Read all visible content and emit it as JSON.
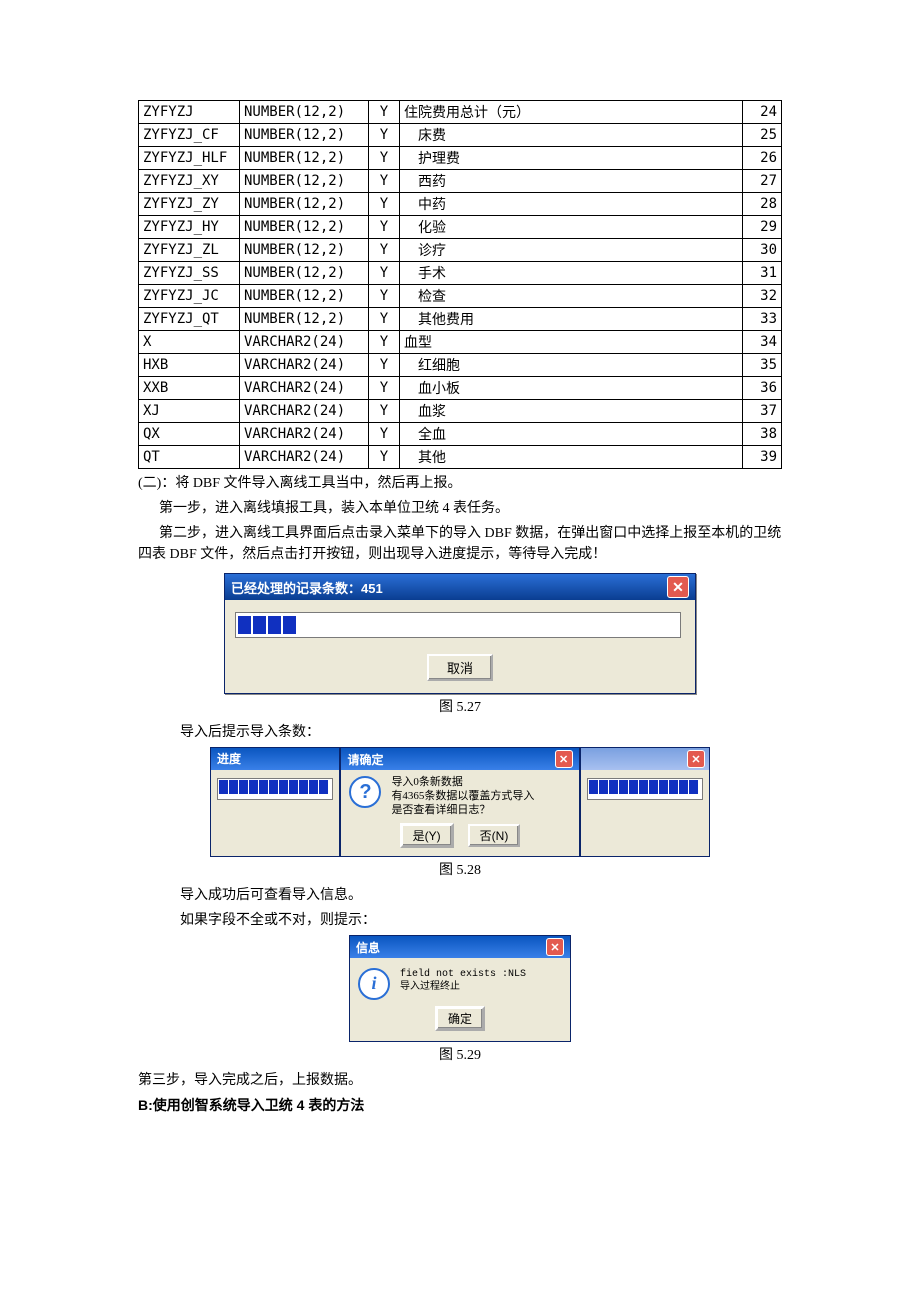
{
  "table_rows": [
    {
      "field": "ZYFYZJ",
      "type": "NUMBER(12,2)",
      "flag": "Y",
      "desc": "住院费用总计（元）",
      "indent": false,
      "num": "24"
    },
    {
      "field": "ZYFYZJ_CF",
      "type": "NUMBER(12,2)",
      "flag": "Y",
      "desc": "床费",
      "indent": true,
      "num": "25"
    },
    {
      "field": "ZYFYZJ_HLF",
      "type": "NUMBER(12,2)",
      "flag": "Y",
      "desc": "护理费",
      "indent": true,
      "num": "26"
    },
    {
      "field": "ZYFYZJ_XY",
      "type": "NUMBER(12,2)",
      "flag": "Y",
      "desc": "西药",
      "indent": true,
      "num": "27"
    },
    {
      "field": "ZYFYZJ_ZY",
      "type": "NUMBER(12,2)",
      "flag": "Y",
      "desc": "中药",
      "indent": true,
      "num": "28"
    },
    {
      "field": "ZYFYZJ_HY",
      "type": "NUMBER(12,2)",
      "flag": "Y",
      "desc": "化验",
      "indent": true,
      "num": "29"
    },
    {
      "field": "ZYFYZJ_ZL",
      "type": "NUMBER(12,2)",
      "flag": "Y",
      "desc": "诊疗",
      "indent": true,
      "num": "30"
    },
    {
      "field": "ZYFYZJ_SS",
      "type": "NUMBER(12,2)",
      "flag": "Y",
      "desc": "手术",
      "indent": true,
      "num": "31"
    },
    {
      "field": "ZYFYZJ_JC",
      "type": "NUMBER(12,2)",
      "flag": "Y",
      "desc": "检查",
      "indent": true,
      "num": "32"
    },
    {
      "field": "ZYFYZJ_QT",
      "type": "NUMBER(12,2)",
      "flag": "Y",
      "desc": "其他费用",
      "indent": true,
      "num": "33"
    },
    {
      "field": "X",
      "type": "VARCHAR2(24)",
      "flag": "Y",
      "desc": "血型",
      "indent": false,
      "num": "34"
    },
    {
      "field": "HXB",
      "type": "VARCHAR2(24)",
      "flag": "Y",
      "desc": "红细胞",
      "indent": true,
      "num": "35"
    },
    {
      "field": "XXB",
      "type": "VARCHAR2(24)",
      "flag": "Y",
      "desc": "血小板",
      "indent": true,
      "num": "36"
    },
    {
      "field": "XJ",
      "type": "VARCHAR2(24)",
      "flag": "Y",
      "desc": "血浆",
      "indent": true,
      "num": "37"
    },
    {
      "field": "QX",
      "type": "VARCHAR2(24)",
      "flag": "Y",
      "desc": "全血",
      "indent": true,
      "num": "38"
    },
    {
      "field": "QT",
      "type": "VARCHAR2(24)",
      "flag": "Y",
      "desc": "其他",
      "indent": true,
      "num": "39"
    }
  ],
  "para": {
    "p2": "(二)：将 DBF 文件导入离线工具当中，然后再上报。",
    "s1": "第一步，进入离线填报工具，装入本单位卫统 4 表任务。",
    "s2a": "第二步，进入离线工具界面后点击录入菜单下的导入 DBF 数据，在弹出窗口中选择上报至本机的卫统四表 DBF 文件，然后点击打开按钮，则出现导入进度提示，等待导入完成！",
    "after1": "导入后提示导入条数：",
    "after2a": "导入成功后可查看导入信息。",
    "after2b": "如果字段不全或不对，则提示：",
    "s3": "第三步，导入完成之后，上报数据。",
    "b": "B:使用创智系统导入卫统 4 表的方法"
  },
  "captions": {
    "c1": "图 5.27",
    "c2": "图 5.28",
    "c3": "图 5.29"
  },
  "dlg1": {
    "title": "已经处理的记录条数：451",
    "btn": "取消"
  },
  "dlg2": {
    "left_title": "进度",
    "mid_title": "请确定",
    "msg_l1": "导入0条新数据",
    "msg_l2": "有4365条数据以覆盖方式导入",
    "msg_l3": "是否查看详细日志？",
    "yes": "是(Y)",
    "no": "否(N)"
  },
  "dlg3": {
    "title": "信息",
    "msg_l1": "field not exists :NLS",
    "msg_l2": "导入过程终止",
    "ok": "确定"
  }
}
